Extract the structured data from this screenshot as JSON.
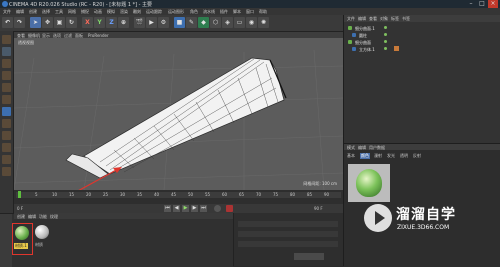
{
  "window": {
    "title": "CINEMA 4D R20.026 Studio (RC - R20) - [未标题 1 *] - 主要"
  },
  "menubar": {
    "items": [
      "文件",
      "编辑",
      "创建",
      "选择",
      "工具",
      "网格",
      "捕捉",
      "动画",
      "模拟",
      "渲染",
      "雕刻",
      "运动跟踪",
      "运动图形",
      "角色",
      "流水线",
      "插件",
      "脚本",
      "窗口",
      "帮助"
    ]
  },
  "toolbar": {
    "buttons": [
      "X",
      "Y",
      "Z"
    ]
  },
  "viewport": {
    "menu": [
      "查看",
      "摄像机",
      "显示",
      "选项",
      "过滤",
      "面板",
      "ProRender"
    ],
    "label": "透视视图",
    "grid_distance": "网格间距: 100 cm"
  },
  "timeline": {
    "ticks": [
      "0",
      "5",
      "10",
      "15",
      "20",
      "25",
      "30",
      "35",
      "40",
      "45",
      "50",
      "55",
      "60",
      "65",
      "70",
      "75",
      "80",
      "85",
      "90"
    ],
    "frame_start": "0 F",
    "frame_end": "90 F"
  },
  "material_panel": {
    "menu": [
      "创建",
      "编辑",
      "功能",
      "纹理"
    ],
    "materials": [
      "材质.1",
      "材质"
    ]
  },
  "object_manager": {
    "tabs": [
      "文件",
      "编辑",
      "查看",
      "对象",
      "标签",
      "书签"
    ],
    "objects": [
      {
        "name": "细分曲面.1"
      },
      {
        "name": "圆柱"
      },
      {
        "name": "细分曲面"
      },
      {
        "name": "立方体.1"
      }
    ]
  },
  "attribute_manager": {
    "tabs": [
      "基本",
      "颜色",
      "漫射",
      "发光",
      "透明",
      "反射"
    ],
    "mode_tabs": [
      "模式",
      "编辑",
      "用户数据"
    ]
  },
  "watermark": {
    "cn": "溜溜自学",
    "url": "ZIXUE.3D66.COM"
  },
  "colors": {
    "accent_red": "#e0362d",
    "mat_green": "#6ab04c"
  }
}
